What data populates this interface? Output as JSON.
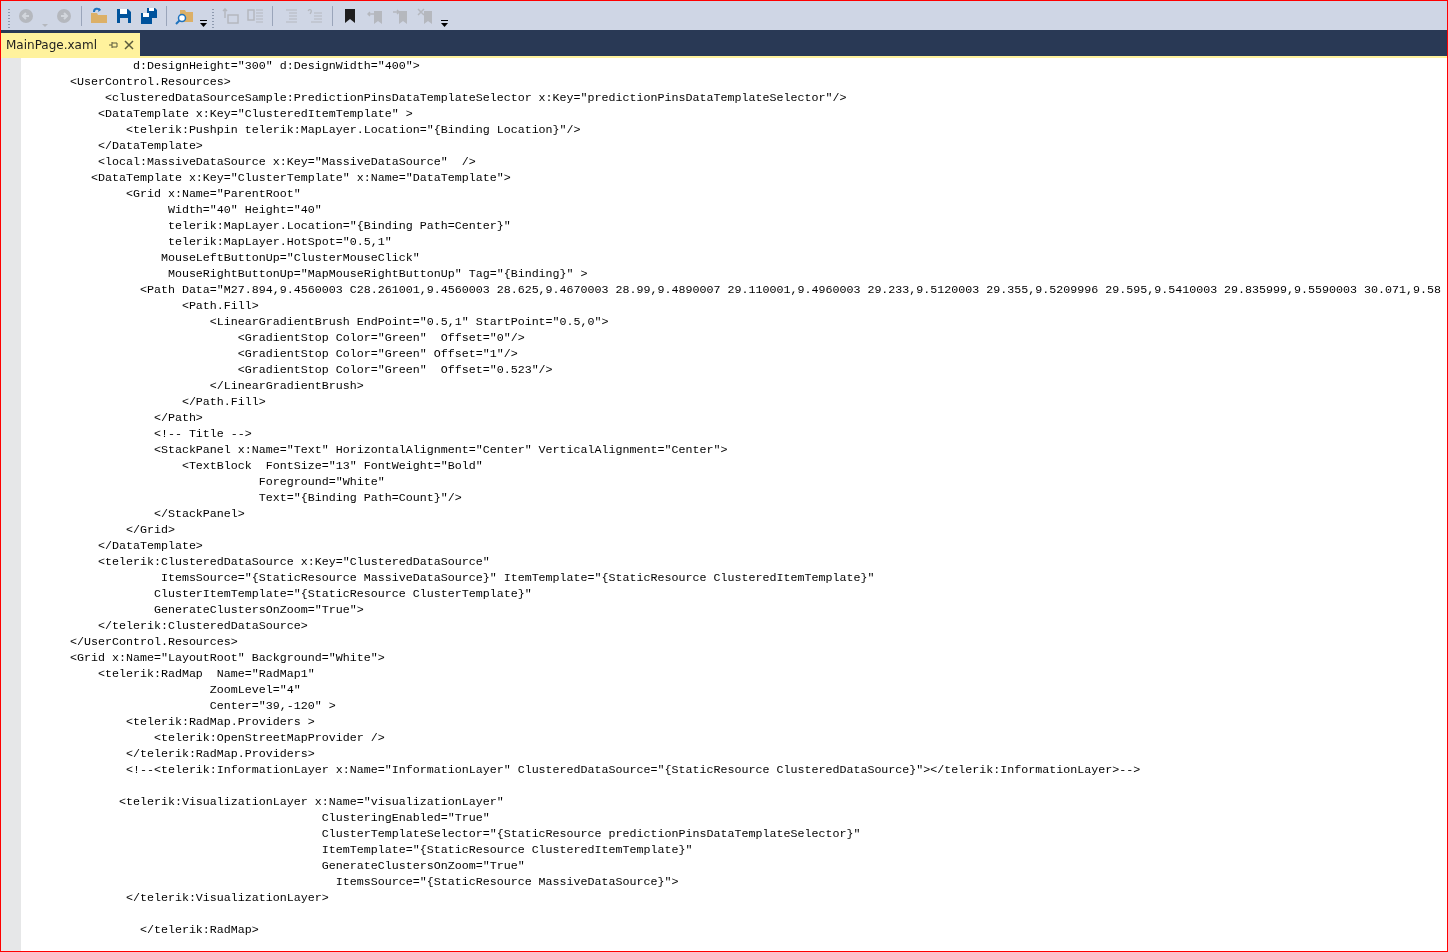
{
  "toolbar": [
    {
      "kind": "grip"
    },
    {
      "kind": "back",
      "disabled": true
    },
    {
      "kind": "caret",
      "disabled": true
    },
    {
      "kind": "forward",
      "disabled": true
    },
    {
      "kind": "separator"
    },
    {
      "kind": "open",
      "disabled": false
    },
    {
      "kind": "save",
      "disabled": false
    },
    {
      "kind": "saveall",
      "disabled": false
    },
    {
      "kind": "separator"
    },
    {
      "kind": "find",
      "disabled": false
    },
    {
      "kind": "overflow",
      "disabled": false
    },
    {
      "kind": "grip"
    },
    {
      "kind": "outdent",
      "disabled": true
    },
    {
      "kind": "indent",
      "disabled": true
    },
    {
      "kind": "separator"
    },
    {
      "kind": "comment",
      "disabled": true
    },
    {
      "kind": "uncomment",
      "disabled": true
    },
    {
      "kind": "separator"
    },
    {
      "kind": "bookmark",
      "disabled": false
    },
    {
      "kind": "prevbookmark",
      "disabled": true
    },
    {
      "kind": "nextbookmark",
      "disabled": true
    },
    {
      "kind": "clearbookmark",
      "disabled": true
    },
    {
      "kind": "overflow",
      "disabled": false
    }
  ],
  "tabs": [
    {
      "label": "MainPage.xaml",
      "selected": true
    }
  ],
  "code_lines": [
    {
      "text": "                d:DesignHeight=\"300\" d:DesignWidth=\"400\">"
    },
    {
      "text": "       <UserControl.Resources>"
    },
    {
      "text": "            <clusteredDataSourceSample:PredictionPinsDataTemplateSelector x:Key=\"predictionPinsDataTemplateSelector\"/>"
    },
    {
      "text": "           <DataTemplate x:Key=\"ClusteredItemTemplate\" >"
    },
    {
      "text": "               <telerik:Pushpin telerik:MapLayer.Location=\"{Binding Location}\"/>"
    },
    {
      "text": "           </DataTemplate>"
    },
    {
      "text": "           <local:MassiveDataSource x:Key=\"MassiveDataSource\"  />"
    },
    {
      "text": "          <DataTemplate x:Key=\"ClusterTemplate\" x:Name=\"DataTemplate\">"
    },
    {
      "text": "               <Grid x:Name=\"ParentRoot\""
    },
    {
      "text": "                     Width=\"40\" Height=\"40\""
    },
    {
      "text": "                     telerik:MapLayer.Location=\"{Binding Path=Center}\""
    },
    {
      "text": "                     telerik:MapLayer.HotSpot=\"0.5,1\""
    },
    {
      "text": "                    MouseLeftButtonUp=\"ClusterMouseClick\""
    },
    {
      "text": "                     MouseRightButtonUp=\"MapMouseRightButtonUp\" Tag=\"{Binding}\" >"
    },
    {
      "text": "                 <Path Data=\"M27.894,9.4560003 C28.261001,9.4560003 28.625,9.4670003 28.99,9.4890007 29.110001,9.4960003 29.233,9.5120003 29.355,9.5209996 29.595,9.5410003 29.835999,9.5590003 30.071,9.58"
    },
    {
      "text": "                       <Path.Fill>"
    },
    {
      "text": "                           <LinearGradientBrush EndPoint=\"0.5,1\" StartPoint=\"0.5,0\">"
    },
    {
      "text": "                               <GradientStop Color=\"Green\"  Offset=\"0\"/>"
    },
    {
      "text": "                               <GradientStop Color=\"Green\" Offset=\"1\"/>"
    },
    {
      "text": "                               <GradientStop Color=\"Green\"  Offset=\"0.523\"/>"
    },
    {
      "text": "                           </LinearGradientBrush>"
    },
    {
      "text": "                       </Path.Fill>"
    },
    {
      "text": "                   </Path>"
    },
    {
      "text": "                   <!-- Title -->"
    },
    {
      "text": "                   <StackPanel x:Name=\"Text\" HorizontalAlignment=\"Center\" VerticalAlignment=\"Center\">"
    },
    {
      "text": "                       <TextBlock  FontSize=\"13\" FontWeight=\"Bold\""
    },
    {
      "text": "                                  Foreground=\"White\""
    },
    {
      "text": "                                  Text=\"{Binding Path=Count}\"/>"
    },
    {
      "text": "                   </StackPanel>"
    },
    {
      "text": "               </Grid>"
    },
    {
      "text": "           </DataTemplate>"
    },
    {
      "text": "           <telerik:ClusteredDataSource x:Key=\"ClusteredDataSource\""
    },
    {
      "text": "                    ItemsSource=\"{StaticResource MassiveDataSource}\" ItemTemplate=\"{StaticResource ClusteredItemTemplate}\""
    },
    {
      "text": "                   ClusterItemTemplate=\"{StaticResource ClusterTemplate}\""
    },
    {
      "text": "                   GenerateClustersOnZoom=\"True\">"
    },
    {
      "text": "           </telerik:ClusteredDataSource>"
    },
    {
      "text": "       </UserControl.Resources>"
    },
    {
      "text": "       <Grid x:Name=\"LayoutRoot\" Background=\"White\">"
    },
    {
      "text": "           <telerik:RadMap  Name=\"RadMap1\""
    },
    {
      "text": "                           ZoomLevel=\"4\""
    },
    {
      "text": "                           Center=\"39,-120\" >"
    },
    {
      "text": "               <telerik:RadMap.Providers >"
    },
    {
      "text": "                   <telerik:OpenStreetMapProvider />"
    },
    {
      "text": "               </telerik:RadMap.Providers>"
    },
    {
      "text": "               <!--<telerik:InformationLayer x:Name=\"InformationLayer\" ClusteredDataSource=\"{StaticResource ClusteredDataSource}\"></telerik:InformationLayer>-->",
      "gap_after": true
    },
    {
      "text": "              <telerik:VisualizationLayer x:Name=\"visualizationLayer\""
    },
    {
      "text": "                                           ClusteringEnabled=\"True\""
    },
    {
      "text": "                                           ClusterTemplateSelector=\"{StaticResource predictionPinsDataTemplateSelector}\""
    },
    {
      "text": "                                           ItemTemplate=\"{StaticResource ClusteredItemTemplate}\""
    },
    {
      "text": "                                           GenerateClustersOnZoom=\"True\""
    },
    {
      "text": "                                             ItemsSource=\"{StaticResource MassiveDataSource}\">"
    },
    {
      "text": "               </telerik:VisualizationLayer>",
      "gap_after": true
    },
    {
      "text": "                 </telerik:RadMap>"
    }
  ]
}
